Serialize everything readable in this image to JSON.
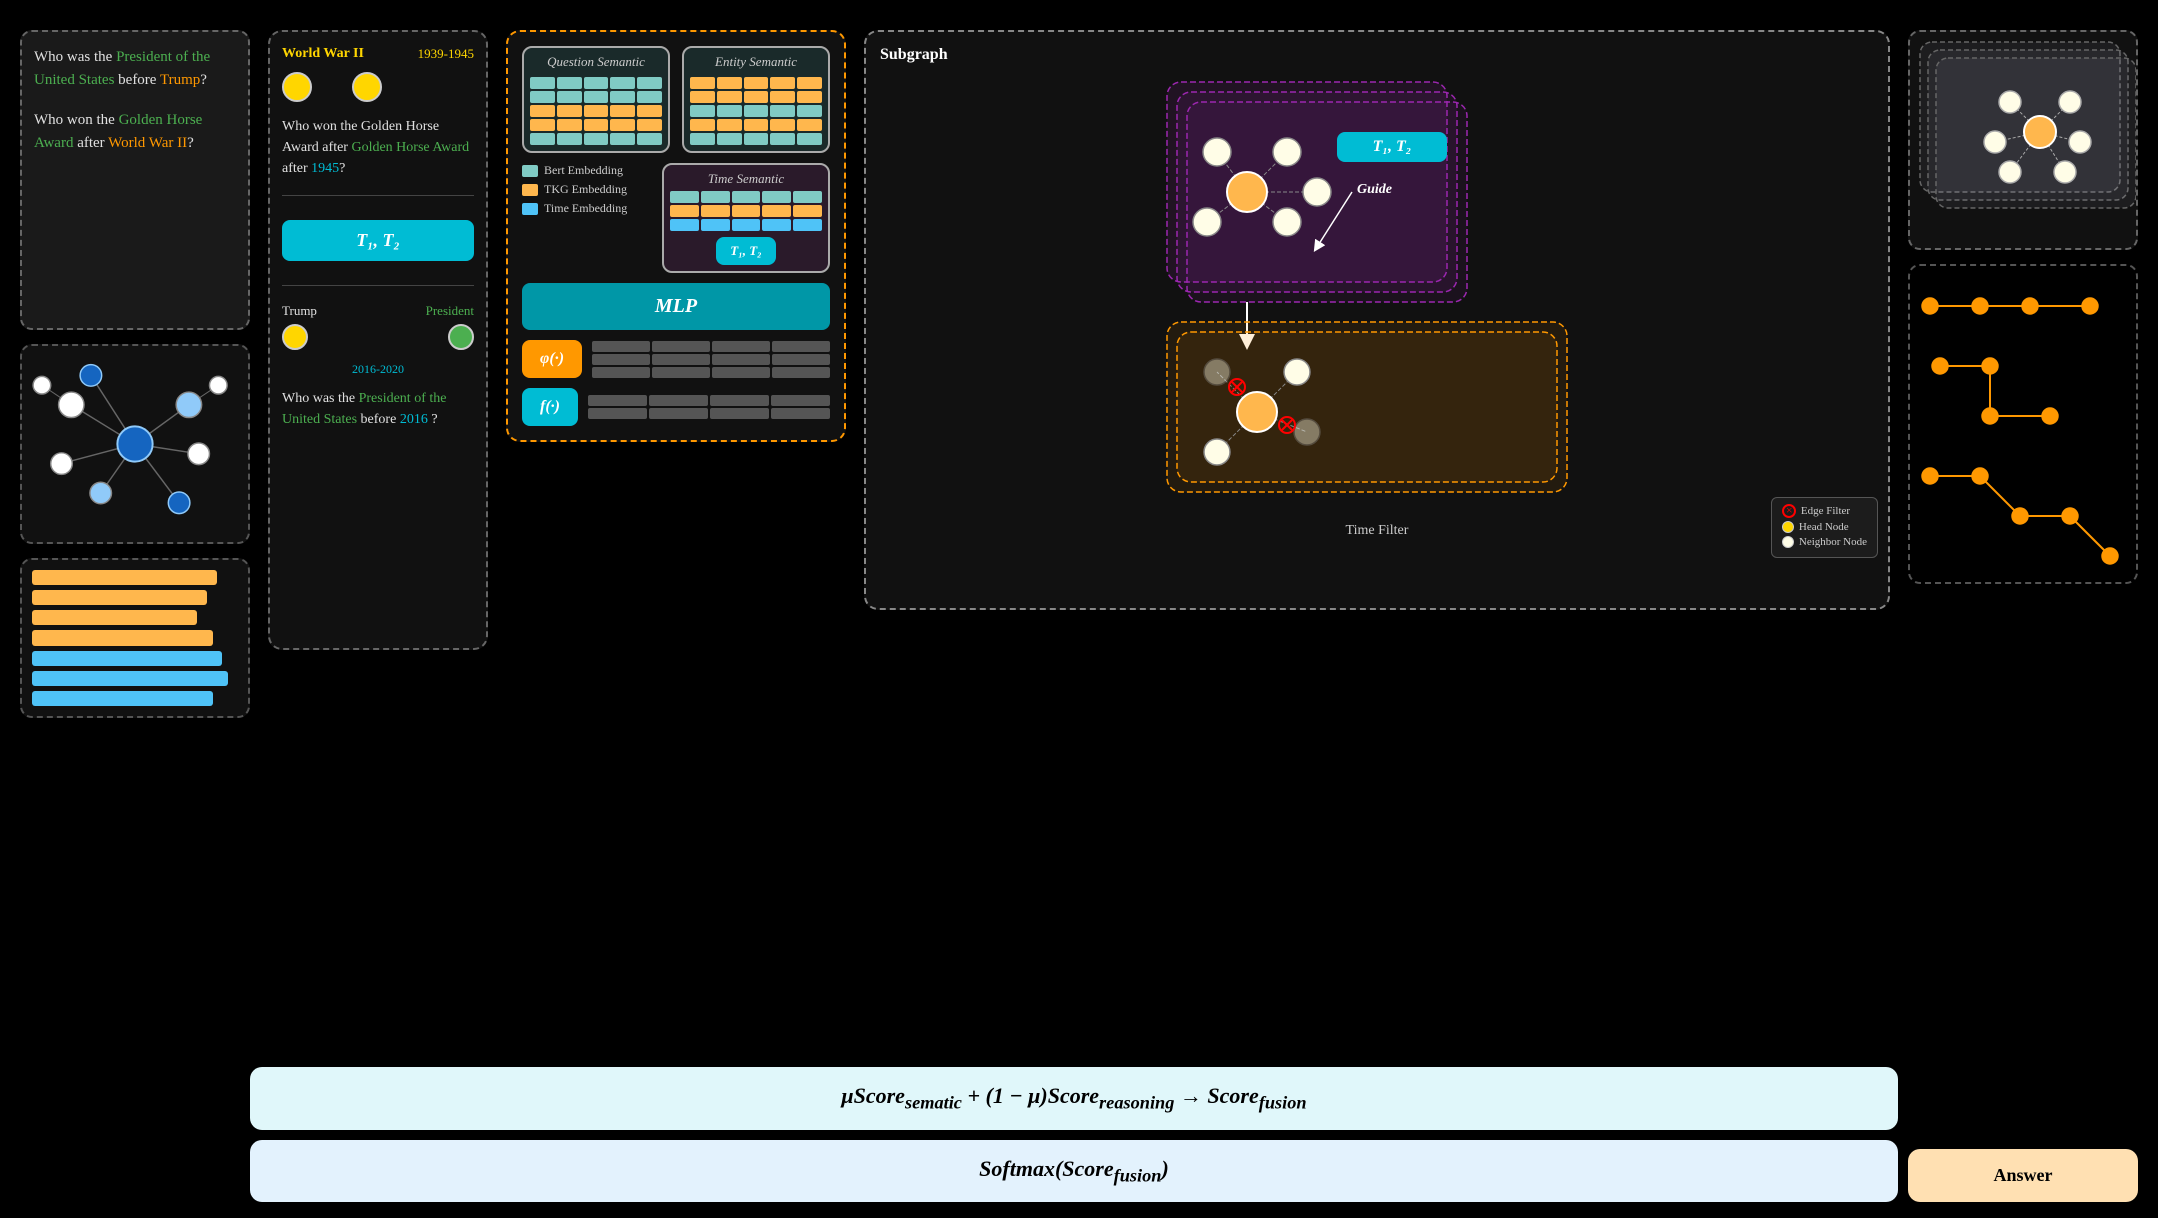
{
  "questions": {
    "q1_part1": "Who was the ",
    "q1_green": "President of the United States",
    "q1_part2": " before ",
    "q1_orange": "Trump",
    "q1_end": "?",
    "q2_part1": "Who won the ",
    "q2_green": "Golden Horse Award",
    "q2_part2": " after ",
    "q2_orange": "World War II",
    "q2_end": "?"
  },
  "timeline": {
    "world_war_ii": "World War II",
    "years_1": "1939-1945",
    "q_golden": "Who won the Golden Horse Award after",
    "year_1945": "1945",
    "t_vars": "T₁, T₂",
    "trump_label": "Trump",
    "president_label": "President",
    "years_2": "2016-2020",
    "q_president_1": "Who was the",
    "q_president_green": "President of the United States",
    "q_president_before": "before",
    "year_2016": "2016",
    "q_mark": "?"
  },
  "semantic": {
    "question_semantic": "Question Semantic",
    "entity_semantic": "Entity Semantic",
    "time_semantic": "Time Semantic",
    "bert": "Bert Embedding",
    "tkg": "TKG Embedding",
    "time_emb": "Time Embedding",
    "t_vars": "T₁, T₂",
    "mlp": "MLP",
    "phi": "φ(·)",
    "f": "f(·)"
  },
  "subgraph": {
    "title": "Subgraph",
    "t_vars": "T₁, T₂",
    "guide": "Guide",
    "time_filter": "Time Filter",
    "legend": {
      "edge_filter": "Edge Filter",
      "head_node": "Head Node",
      "neighbor_node": "Neighbor Node"
    }
  },
  "bottom": {
    "formula": "μScore_sematic + (1 − μ)Score_reasoning → Score_fusion",
    "softmax": "Softmax(Score_fusion)",
    "answer": "Answer"
  },
  "colors": {
    "teal": "#80cbc4",
    "orange_cell": "#ffb74d",
    "blue_cell": "#4fc3f7",
    "cyan_box": "#00bcd4",
    "orange_box": "#ff9800"
  }
}
